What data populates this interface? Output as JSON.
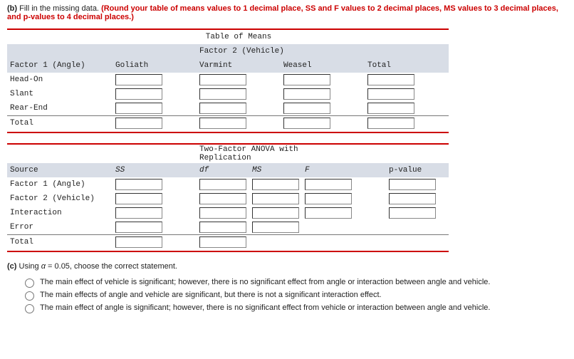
{
  "partB": {
    "label": "(b)",
    "lead": "Fill in the missing data.",
    "redText": "(Round your table of means values to 1 decimal place, SS and F values to 2 decimal places, MS values to 3 decimal places, and p-values to 4 decimal places.)"
  },
  "meansTable": {
    "title": "Table of Means",
    "factor2Label": "Factor 2 (Vehicle)",
    "factor1Label": "Factor 1 (Angle)",
    "cols": [
      "Goliath",
      "Varmint",
      "Weasel",
      "Total"
    ],
    "rows": [
      "Head-On",
      "Slant",
      "Rear-End",
      "Total"
    ]
  },
  "anovaTable": {
    "title": "Two-Factor ANOVA with Replication",
    "sourceLabel": "Source",
    "cols": [
      "SS",
      "df",
      "MS",
      "F",
      "p-value"
    ],
    "rows": [
      {
        "label": "Factor 1 (Angle)",
        "cells": [
          true,
          true,
          true,
          true,
          true
        ]
      },
      {
        "label": "Factor 2 (Vehicle)",
        "cells": [
          true,
          true,
          true,
          true,
          true
        ]
      },
      {
        "label": "Interaction",
        "cells": [
          true,
          true,
          true,
          true,
          true
        ]
      },
      {
        "label": "Error",
        "cells": [
          true,
          true,
          true,
          false,
          false
        ]
      },
      {
        "label": "Total",
        "cells": [
          true,
          true,
          false,
          false,
          false
        ]
      }
    ]
  },
  "partC": {
    "label": "(c)",
    "lead": "Using α = 0.05, choose the correct statement.",
    "alphaVar": "α",
    "options": [
      "The main effect of vehicle is significant; however, there is no significant effect from angle or interaction between angle and vehicle.",
      "The main effects of angle and vehicle are significant, but there is not a significant interaction effect.",
      "The main effect of angle is significant; however, there is no significant effect from vehicle or interaction between angle and vehicle."
    ]
  }
}
